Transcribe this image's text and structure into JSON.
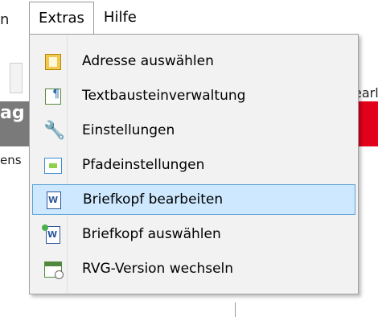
{
  "background": {
    "menu_edge_text": "n",
    "red_band_text": "ag",
    "left_text": "ens",
    "right_text": "earl",
    "brand_red": "#e2001a"
  },
  "menubar": {
    "extras_label": "Extras",
    "hilfe_label": "Hilfe"
  },
  "dropdown": {
    "highlight_bg": "#cde8ff",
    "highlight_border": "#5aa2d8",
    "items": [
      {
        "label": "Adresse auswählen",
        "icon": "address-book-icon"
      },
      {
        "label": "Textbausteinverwaltung",
        "icon": "text-block-icon"
      },
      {
        "label": "Einstellungen",
        "icon": "wrench-icon"
      },
      {
        "label": "Pfadeinstellungen",
        "icon": "path-settings-icon"
      },
      {
        "label": "Briefkopf bearbeiten",
        "icon": "word-document-icon",
        "highlighted": true
      },
      {
        "label": "Briefkopf auswählen",
        "icon": "word-document-select-icon"
      },
      {
        "label": "RVG-Version wechseln",
        "icon": "calendar-clock-icon"
      }
    ]
  }
}
